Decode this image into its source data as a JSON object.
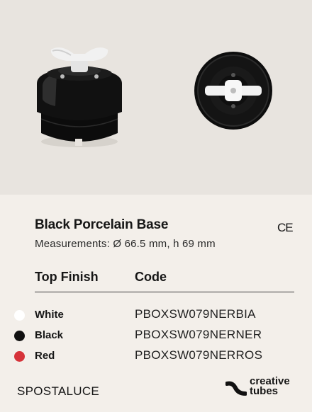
{
  "product": {
    "title": "Black Porcelain Base",
    "certification": "CE",
    "measurements": "Measurements: Ø 66.5 mm, h 69 mm"
  },
  "table": {
    "headers": {
      "finish": "Top Finish",
      "code": "Code"
    },
    "rows": [
      {
        "finish": "White",
        "code": "PBOXSW079NERBIA",
        "color": "#ffffff"
      },
      {
        "finish": "Black",
        "code": "PBOXSW079NERNER",
        "color": "#111111"
      },
      {
        "finish": "Red",
        "code": "PBOXSW079NERROS",
        "color": "#d6333a"
      }
    ]
  },
  "footer": {
    "brand": "SPOSTALUCE",
    "partner_line1": "creative",
    "partner_line2": "tubes"
  },
  "images": {
    "side_view_icon": "porcelain-switch-side-view",
    "top_view_icon": "porcelain-switch-top-view"
  }
}
